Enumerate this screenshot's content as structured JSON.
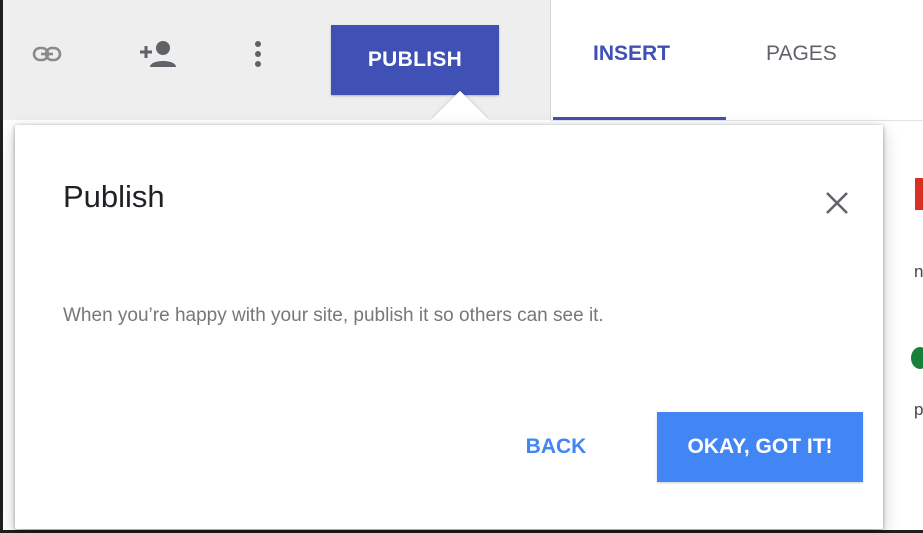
{
  "toolbar": {
    "link_icon": "link-icon",
    "add_person_icon": "add-person-icon",
    "more_icon": "more-vert-icon",
    "publish_label": "PUBLISH"
  },
  "tabs": [
    {
      "label": "INSERT",
      "active": true
    },
    {
      "label": "PAGES",
      "active": false
    }
  ],
  "dialog": {
    "title": "Publish",
    "close_icon": "close-icon",
    "body": "When you’re happy with your site, publish it so others can see it.",
    "back_label": "BACK",
    "ok_label": "OKAY, GOT IT!"
  },
  "background_fragments": [
    "n",
    "p"
  ],
  "colors": {
    "primary": "#3f51b5",
    "accent_blue": "#4285f4",
    "toolbar_bg": "#eeeeee"
  }
}
